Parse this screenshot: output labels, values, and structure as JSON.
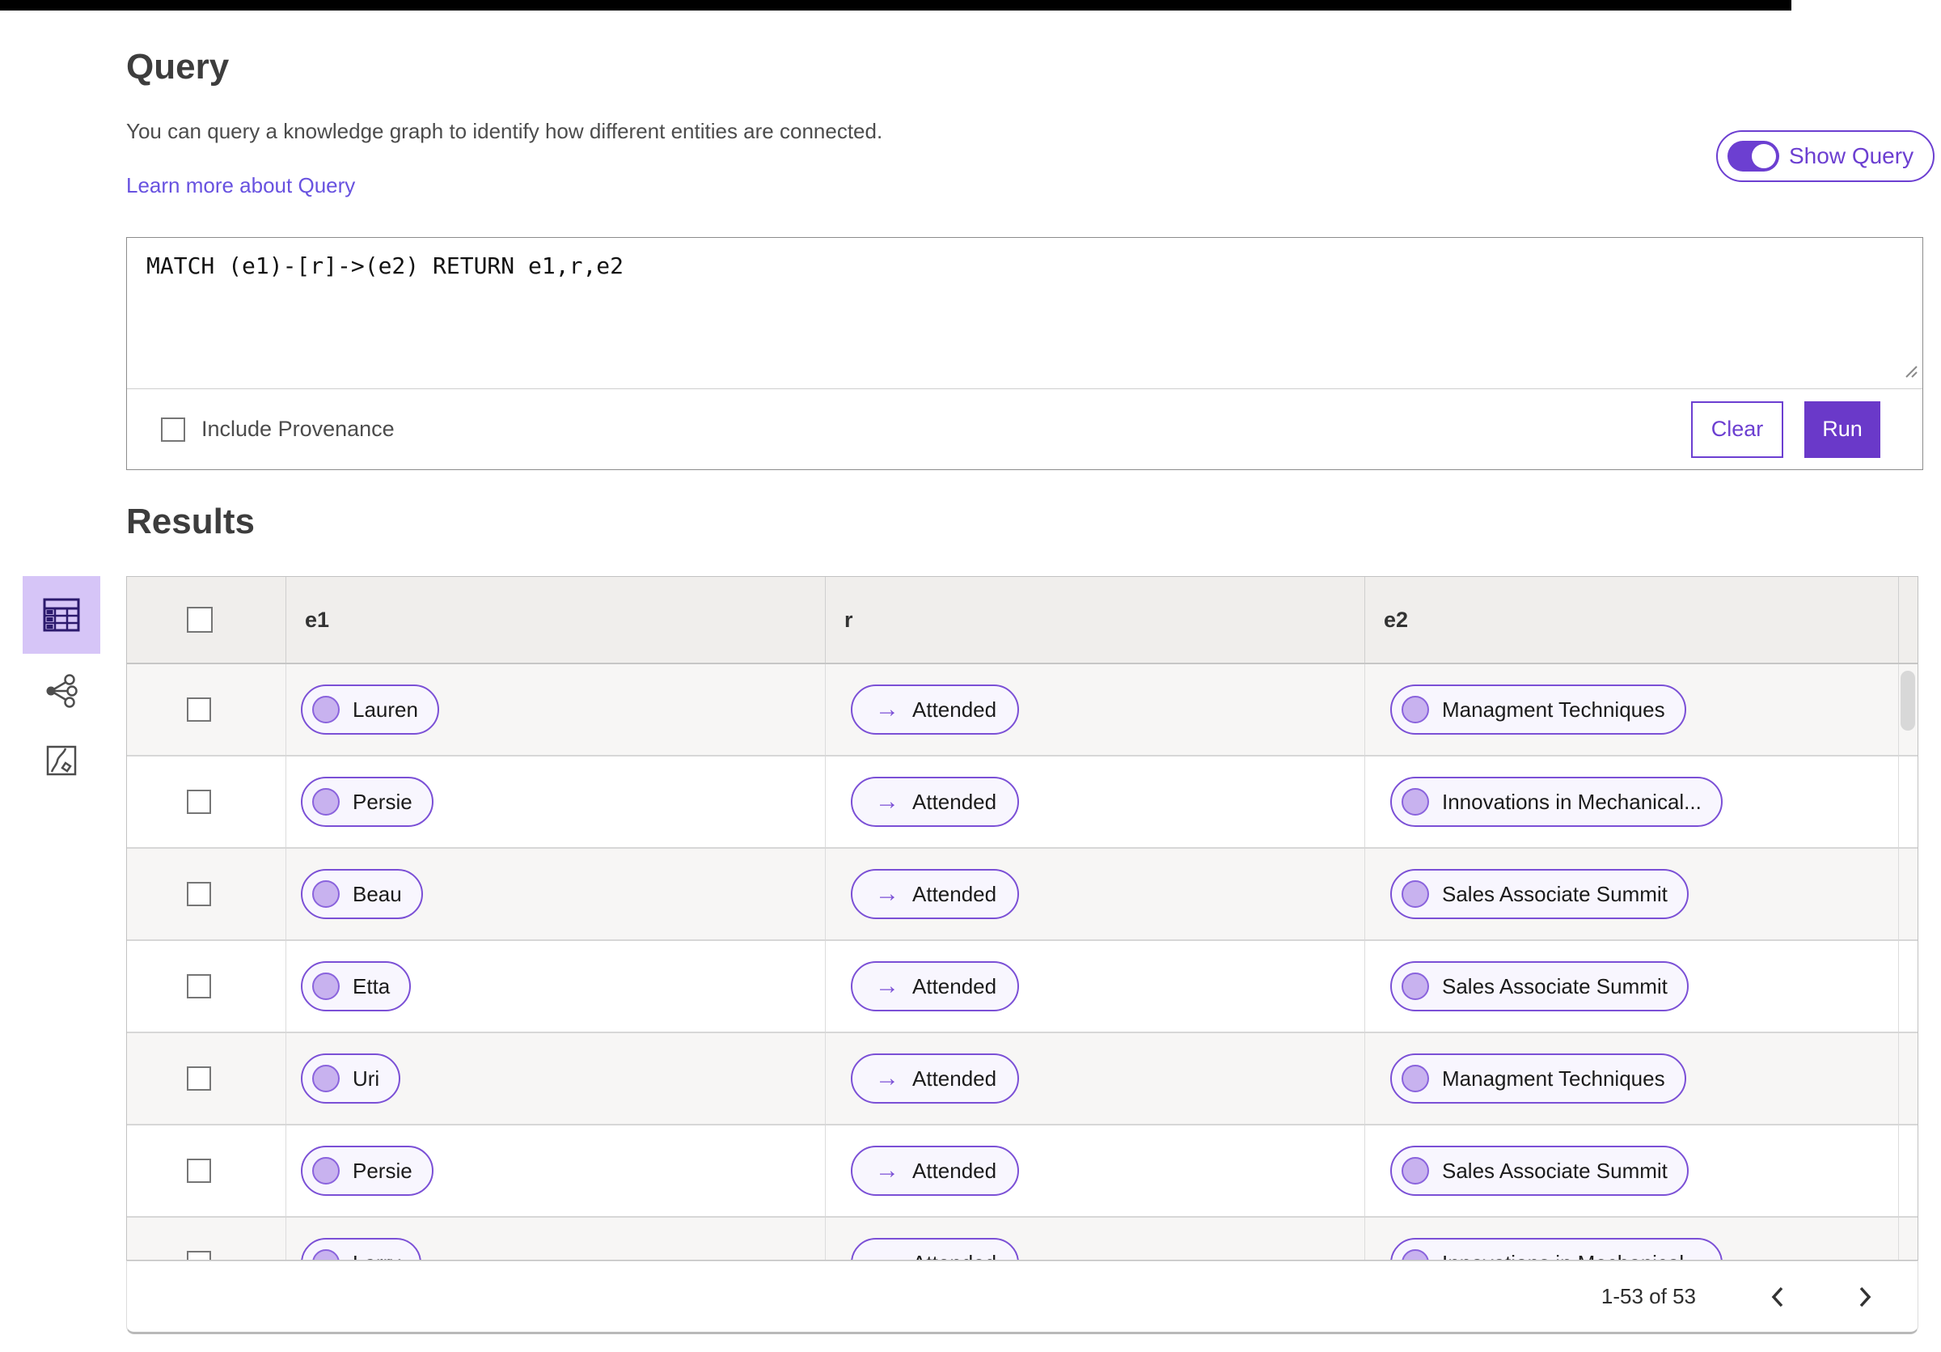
{
  "header": {
    "title": "Query",
    "description": "You can query a knowledge graph to identify how different entities are connected.",
    "learn_more_link": "Learn more about Query",
    "show_query": {
      "label": "Show Query",
      "on": true
    }
  },
  "query_editor": {
    "query_text": "MATCH (e1)-[r]->(e2) RETURN e1,r,e2",
    "include_provenance": {
      "label": "Include Provenance",
      "checked": false
    },
    "clear_label": "Clear",
    "run_label": "Run"
  },
  "results": {
    "title": "Results",
    "view_switcher": {
      "selected": "table-view",
      "icons": [
        "table-view-icon",
        "graph-view-icon",
        "map-view-icon"
      ]
    },
    "columns": [
      "e1",
      "r",
      "e2"
    ],
    "relation_arrow": "→",
    "rows": [
      {
        "e1": "Lauren",
        "r": "Attended",
        "e2": "Managment Techniques"
      },
      {
        "e1": "Persie",
        "r": "Attended",
        "e2": "Innovations in Mechanical..."
      },
      {
        "e1": "Beau",
        "r": "Attended",
        "e2": "Sales Associate Summit"
      },
      {
        "e1": "Etta",
        "r": "Attended",
        "e2": "Sales Associate Summit"
      },
      {
        "e1": "Uri",
        "r": "Attended",
        "e2": "Managment Techniques"
      },
      {
        "e1": "Persie",
        "r": "Attended",
        "e2": "Sales Associate Summit"
      },
      {
        "e1": "Larry",
        "r": "Attended",
        "e2": "Innovations in Mechanical..."
      }
    ],
    "pagination": {
      "range_label": "1-53 of 53"
    }
  },
  "colors": {
    "accent_purple": "#6c3fd1",
    "run_button": "#6a39c9",
    "pill_border": "#7b50d6",
    "pill_background": "#f8f6fe",
    "pill_dot_fill": "#c8b2ef",
    "link": "#6852e0",
    "selected_view_background": "#d6c5f7",
    "table_header_background": "#f0eeec",
    "row_alt_background": "#f7f6f5",
    "topbar": "#000000"
  }
}
